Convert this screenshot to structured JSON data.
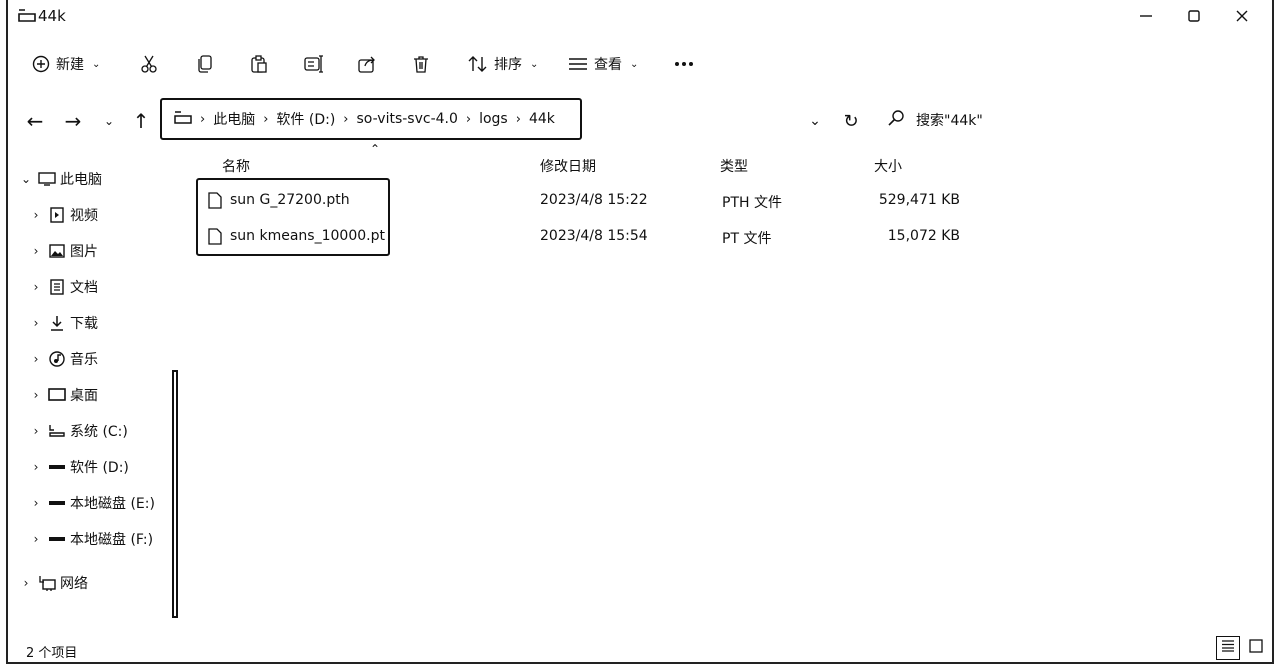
{
  "window": {
    "title": "44k",
    "title_icon": "folder-icon",
    "controls": [
      "minimize-icon",
      "maximize-icon",
      "close-icon"
    ]
  },
  "toolbar": {
    "new_label": "新建",
    "sort_label": "排序",
    "view_label": "查看",
    "icons": [
      "new-icon",
      "cut-icon",
      "copy-icon",
      "paste-icon",
      "rename-icon",
      "share-icon",
      "delete-icon",
      "sort-icon",
      "view-icon",
      "more-icon"
    ]
  },
  "nav": {
    "breadcrumb": [
      "此电脑",
      "软件 (D:)",
      "so-vits-svc-4.0",
      "logs",
      "44k"
    ],
    "search_placeholder": "搜索\"44k\""
  },
  "sidebar": {
    "items": [
      {
        "label": "此电脑",
        "icon": "computer-icon",
        "expanded": true
      },
      {
        "label": "视频",
        "icon": "video-icon"
      },
      {
        "label": "图片",
        "icon": "pictures-icon"
      },
      {
        "label": "文档",
        "icon": "documents-icon"
      },
      {
        "label": "下载",
        "icon": "download-icon"
      },
      {
        "label": "音乐",
        "icon": "music-icon"
      },
      {
        "label": "桌面",
        "icon": "desktop-icon"
      },
      {
        "label": "系统 (C:)",
        "icon": "drive-c-icon"
      },
      {
        "label": "软件 (D:)",
        "icon": "drive-icon"
      },
      {
        "label": "本地磁盘 (E:)",
        "icon": "drive-icon"
      },
      {
        "label": "本地磁盘 (F:)",
        "icon": "drive-icon"
      },
      {
        "label": "网络",
        "icon": "network-icon"
      }
    ]
  },
  "table": {
    "columns": [
      "名称",
      "修改日期",
      "类型",
      "大小"
    ],
    "rows": [
      {
        "name": "sun G_27200.pth",
        "date": "2023/4/8 15:22",
        "type": "PTH 文件",
        "size": "529,471 KB"
      },
      {
        "name": "sun kmeans_10000.pt",
        "date": "2023/4/8 15:54",
        "type": "PT 文件",
        "size": "15,072 KB"
      }
    ]
  },
  "status": {
    "count_text": "2 个项目"
  }
}
